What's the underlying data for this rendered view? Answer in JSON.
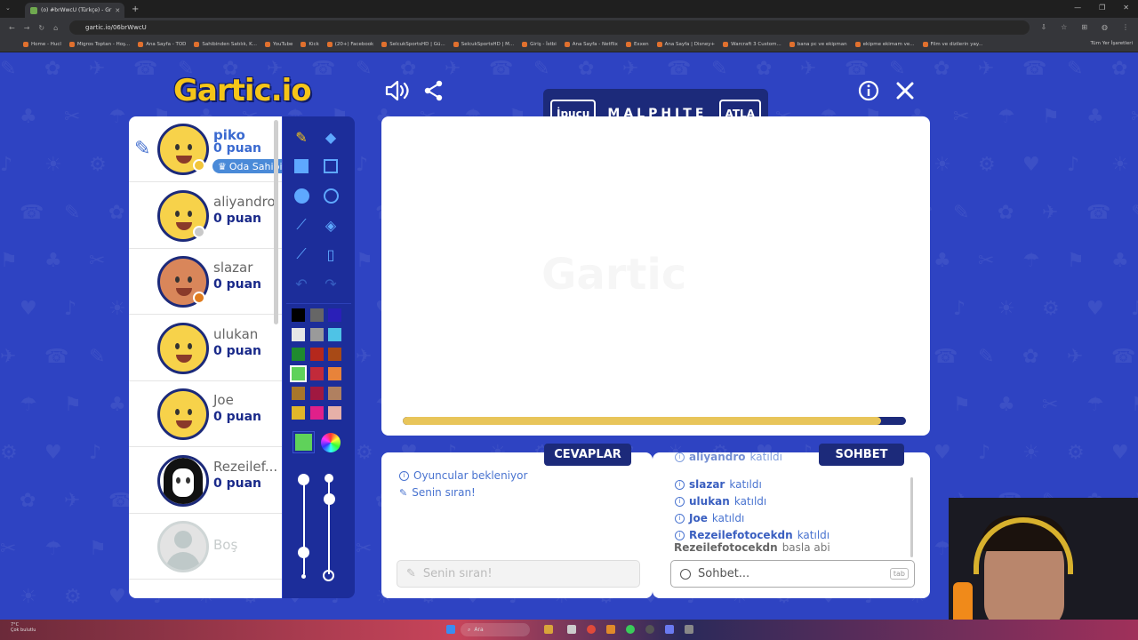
{
  "browser": {
    "tab_title": "(o) #brWwcU (Türkçe) - Gr",
    "url": "gartic.io/06brWwcU",
    "bookmarks": [
      "Home - Hucl",
      "Migros Toptan - Hoş...",
      "Ana Sayfa - TOD",
      "Sahibinden Satılık, K...",
      "YouTube",
      "Kick",
      "(20+) Facebook",
      "SelcukSportsHD | Gü...",
      "SelcukSportsHD | M...",
      "Giriş - İstbi",
      "Ana Sayfa - Netflix",
      "Exxen",
      "Ana Sayfa | Disney+",
      "Warcraft 3 Custom...",
      "bana pc ve ekipman",
      "ekipme ekimam ve...",
      "Film ve dizilerin yay..."
    ],
    "all_bookmarks": "Tüm Yer İşaretleri"
  },
  "header": {
    "logo_text": "Gartic",
    "logo_suffix": ".io"
  },
  "word_bar": {
    "hint_label": "İpucu",
    "word": "MALPHITE",
    "skip_label": "ATLA"
  },
  "players": [
    {
      "name": "piko",
      "points": "0 puan",
      "badge": "Oda Sahibi",
      "drawing": true,
      "dot_color": "#f2c53a",
      "skin": "#f7d24a"
    },
    {
      "name": "aliyandro",
      "points": "0 puan",
      "dot_color": "#c9c9c9",
      "skin": "#f7d24a"
    },
    {
      "name": "slazar",
      "points": "0 puan",
      "dot_color": "#e07b1d",
      "skin": "#d9865a"
    },
    {
      "name": "ulukan",
      "points": "0 puan",
      "skin": "#f7d24a"
    },
    {
      "name": "Joe",
      "points": "0 puan",
      "skin": "#f7d24a"
    },
    {
      "name": "Rezeilef...",
      "points": "0 puan",
      "skin": "#ffffff"
    },
    {
      "name": "Boş",
      "points": "",
      "skin": "#e3e3e3"
    }
  ],
  "palette": [
    "#000000",
    "#666666",
    "#2a1fb8",
    "#e6e6e6",
    "#9a9a9a",
    "#4ec3e6",
    "#1f8a2e",
    "#b5281c",
    "#a84a16",
    "#5fd25a",
    "#c22a3a",
    "#e8833a",
    "#a8762a",
    "#a01840",
    "#b08060",
    "#e2b72a",
    "#e0208a",
    "#e6b0a8"
  ],
  "selected_color": "#5fd25a",
  "answers": {
    "title": "CEVAPLAR",
    "messages": [
      "Oyuncular bekleniyor",
      "Senin sıran!"
    ],
    "input_placeholder": "Senin sıran!"
  },
  "chat": {
    "title": "SOHBET",
    "joined_suffix": "katıldı",
    "messages": [
      {
        "user": "aliyandro"
      },
      {
        "user": "slazar"
      },
      {
        "user": "ulukan"
      },
      {
        "user": "Joe"
      },
      {
        "user": "Rezeilefotocekdn"
      }
    ],
    "last_message": {
      "user": "Rezeilefotocekdn",
      "text": "basla abi"
    },
    "input_placeholder": "Sohbet...",
    "tab_hint": "tab"
  },
  "timer_progress": 0.95,
  "taskbar": {
    "weather_temp": "7°C",
    "weather_desc": "Çok bulutlu",
    "search": "Ara"
  }
}
